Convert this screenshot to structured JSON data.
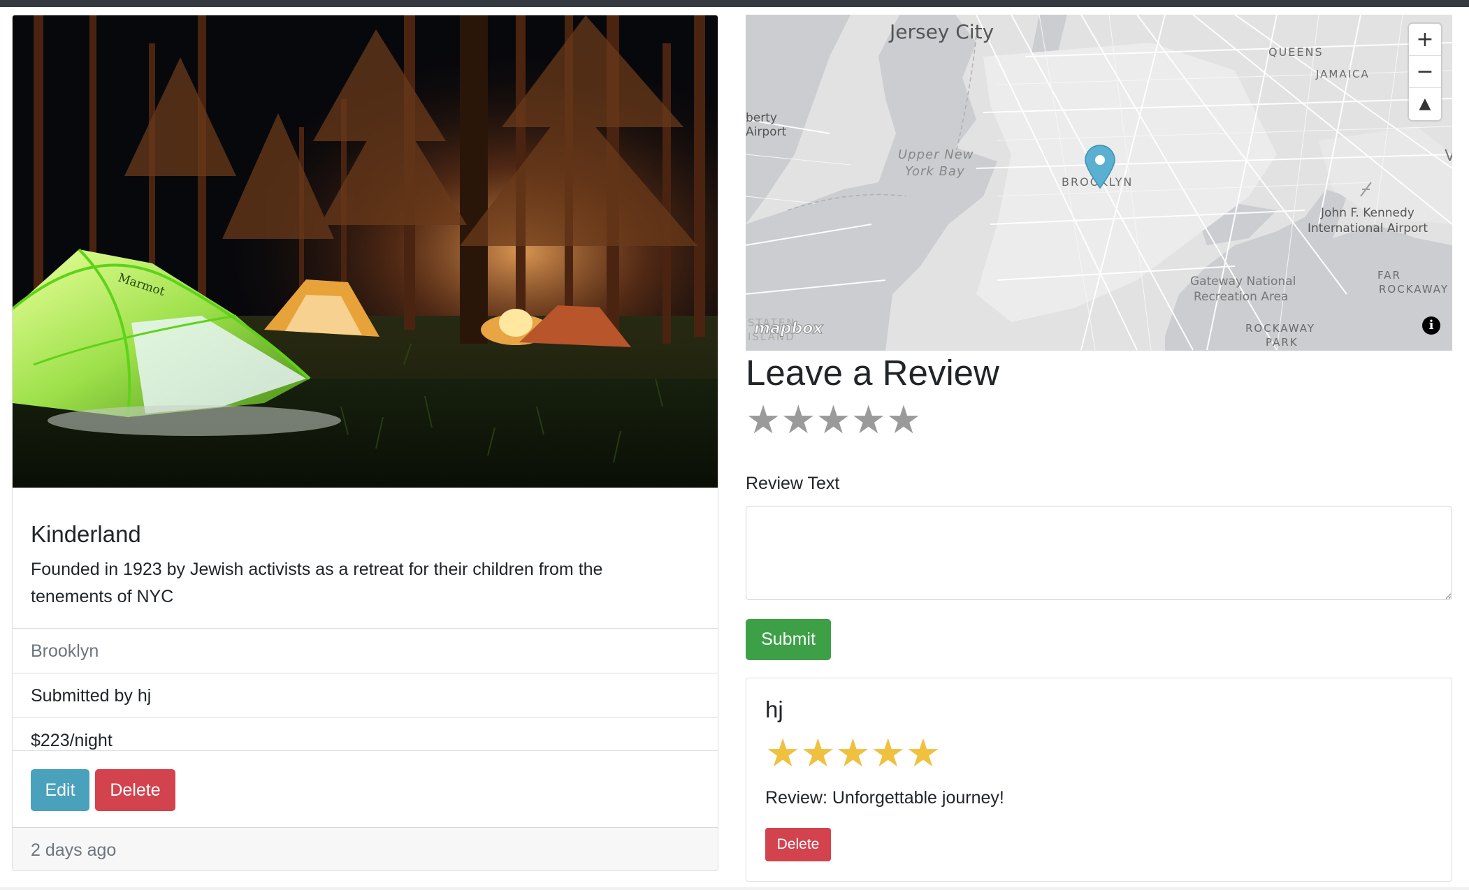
{
  "campground": {
    "title": "Kinderland",
    "description": "Founded in 1923 by Jewish activists as a retreat for their children from the tenements of NYC",
    "location": "Brooklyn",
    "submitted_by": "Submitted by hj",
    "price": "$223/night",
    "edit_label": "Edit",
    "delete_label": "Delete",
    "posted": "2 days ago",
    "image_brand": "Marmot"
  },
  "map": {
    "labels": {
      "jersey_city": "Jersey City",
      "queens": "QUEENS",
      "jamaica": "JAMAICA",
      "liberty_airport_1": "berty",
      "liberty_airport_2": "Airport",
      "upper_bay_1": "Upper New",
      "upper_bay_2": "York Bay",
      "brooklyn": "BROOKLYN",
      "jfk_1": "John F. Kennedy",
      "jfk_2": "International Airport",
      "gateway_1": "Gateway National",
      "gateway_2": "Recreation Area",
      "far_rockaway_1": "FAR",
      "far_rockaway_2": "ROCKAWAY",
      "rockaway_park_1": "ROCKAWAY",
      "rockaway_park_2": "PARK",
      "staten_1": "STATEN",
      "staten_2": "ISLAND",
      "edge_v": "V"
    },
    "zoom_in": "+",
    "zoom_out": "−",
    "compass": "▲",
    "attribution": "mapbox",
    "info": "i",
    "marker_color": "#5ab0d1"
  },
  "review_form": {
    "title": "Leave a Review",
    "stars": [
      "★",
      "★",
      "★",
      "★",
      "★"
    ],
    "text_label": "Review Text",
    "text_value": "",
    "submit_label": "Submit"
  },
  "reviews": [
    {
      "author": "hj",
      "rating": 5,
      "stars": [
        "★",
        "★",
        "★",
        "★",
        "★"
      ],
      "text": "Review: Unforgettable journey!",
      "delete_label": "Delete"
    }
  ],
  "colors": {
    "edit": "#4aa1bc",
    "delete": "#d2434e",
    "submit": "#3da047",
    "star_filled": "#f0c040",
    "star_empty": "#9a9a9a"
  }
}
